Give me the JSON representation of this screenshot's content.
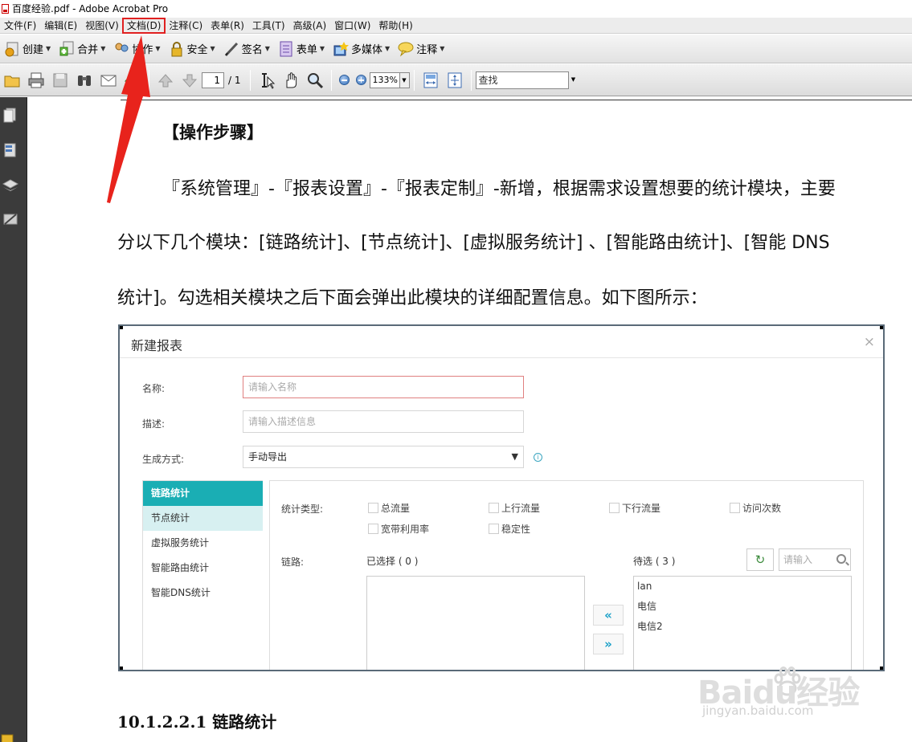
{
  "window": {
    "title": "百度经验.pdf - Adobe Acrobat Pro"
  },
  "menu": [
    "文件(F)",
    "编辑(E)",
    "视图(V)",
    "文档(D)",
    "注释(C)",
    "表单(R)",
    "工具(T)",
    "高级(A)",
    "窗口(W)",
    "帮助(H)"
  ],
  "menu_highlighted": "文档(D)",
  "toolbar1": {
    "create": "创建",
    "combine": "合并",
    "collaborate": "协作",
    "secure": "安全",
    "sign": "签名",
    "forms": "表单",
    "multimedia": "多媒体",
    "comment": "注释"
  },
  "toolbar2": {
    "page_current": "1",
    "page_total": "/ 1",
    "zoom": "133%",
    "find_placeholder": "查找"
  },
  "doc": {
    "steps_heading": "【操作步骤】",
    "para_line1": "『系统管理』-『报表设置』-『报表定制』-新增，根据需求设置想要的统计模块，主要",
    "para_line2": "分以下几个模块：[链路统计]、[节点统计]、[虚拟服务统计] 、[智能路由统计]、[智能 DNS",
    "para_line3": "统计]。勾选相关模块之后下面会弹出此模块的详细配置信息。如下图所示：",
    "subheading": "10.1.2.2.1  链路统计"
  },
  "dialog": {
    "title": "新建报表",
    "close": "×",
    "name_label": "名称:",
    "name_placeholder": "请输入名称",
    "desc_label": "描述:",
    "desc_placeholder": "请输入描述信息",
    "method_label": "生成方式:",
    "method_value": "手动导出",
    "tabs": [
      "链路统计",
      "节点统计",
      "虚拟服务统计",
      "智能路由统计",
      "智能DNS统计"
    ],
    "stat_type_label": "统计类型:",
    "stat_types": [
      "总流量",
      "上行流量",
      "下行流量",
      "访问次数",
      "宽带利用率",
      "稳定性"
    ],
    "link_label": "链路:",
    "selected_label": "已选择 ( 0 )",
    "pending_label": "待选 ( 3 )",
    "search_placeholder": "请输入",
    "pending_items": [
      "lan",
      "电信",
      "电信2"
    ],
    "move_left": "«",
    "move_right": "»"
  },
  "watermark": {
    "brand": "Baidu经验",
    "url": "jingyan.baidu.com"
  },
  "colors": {
    "accent_teal": "#1aaeb4",
    "annotation_red": "#e02020"
  }
}
